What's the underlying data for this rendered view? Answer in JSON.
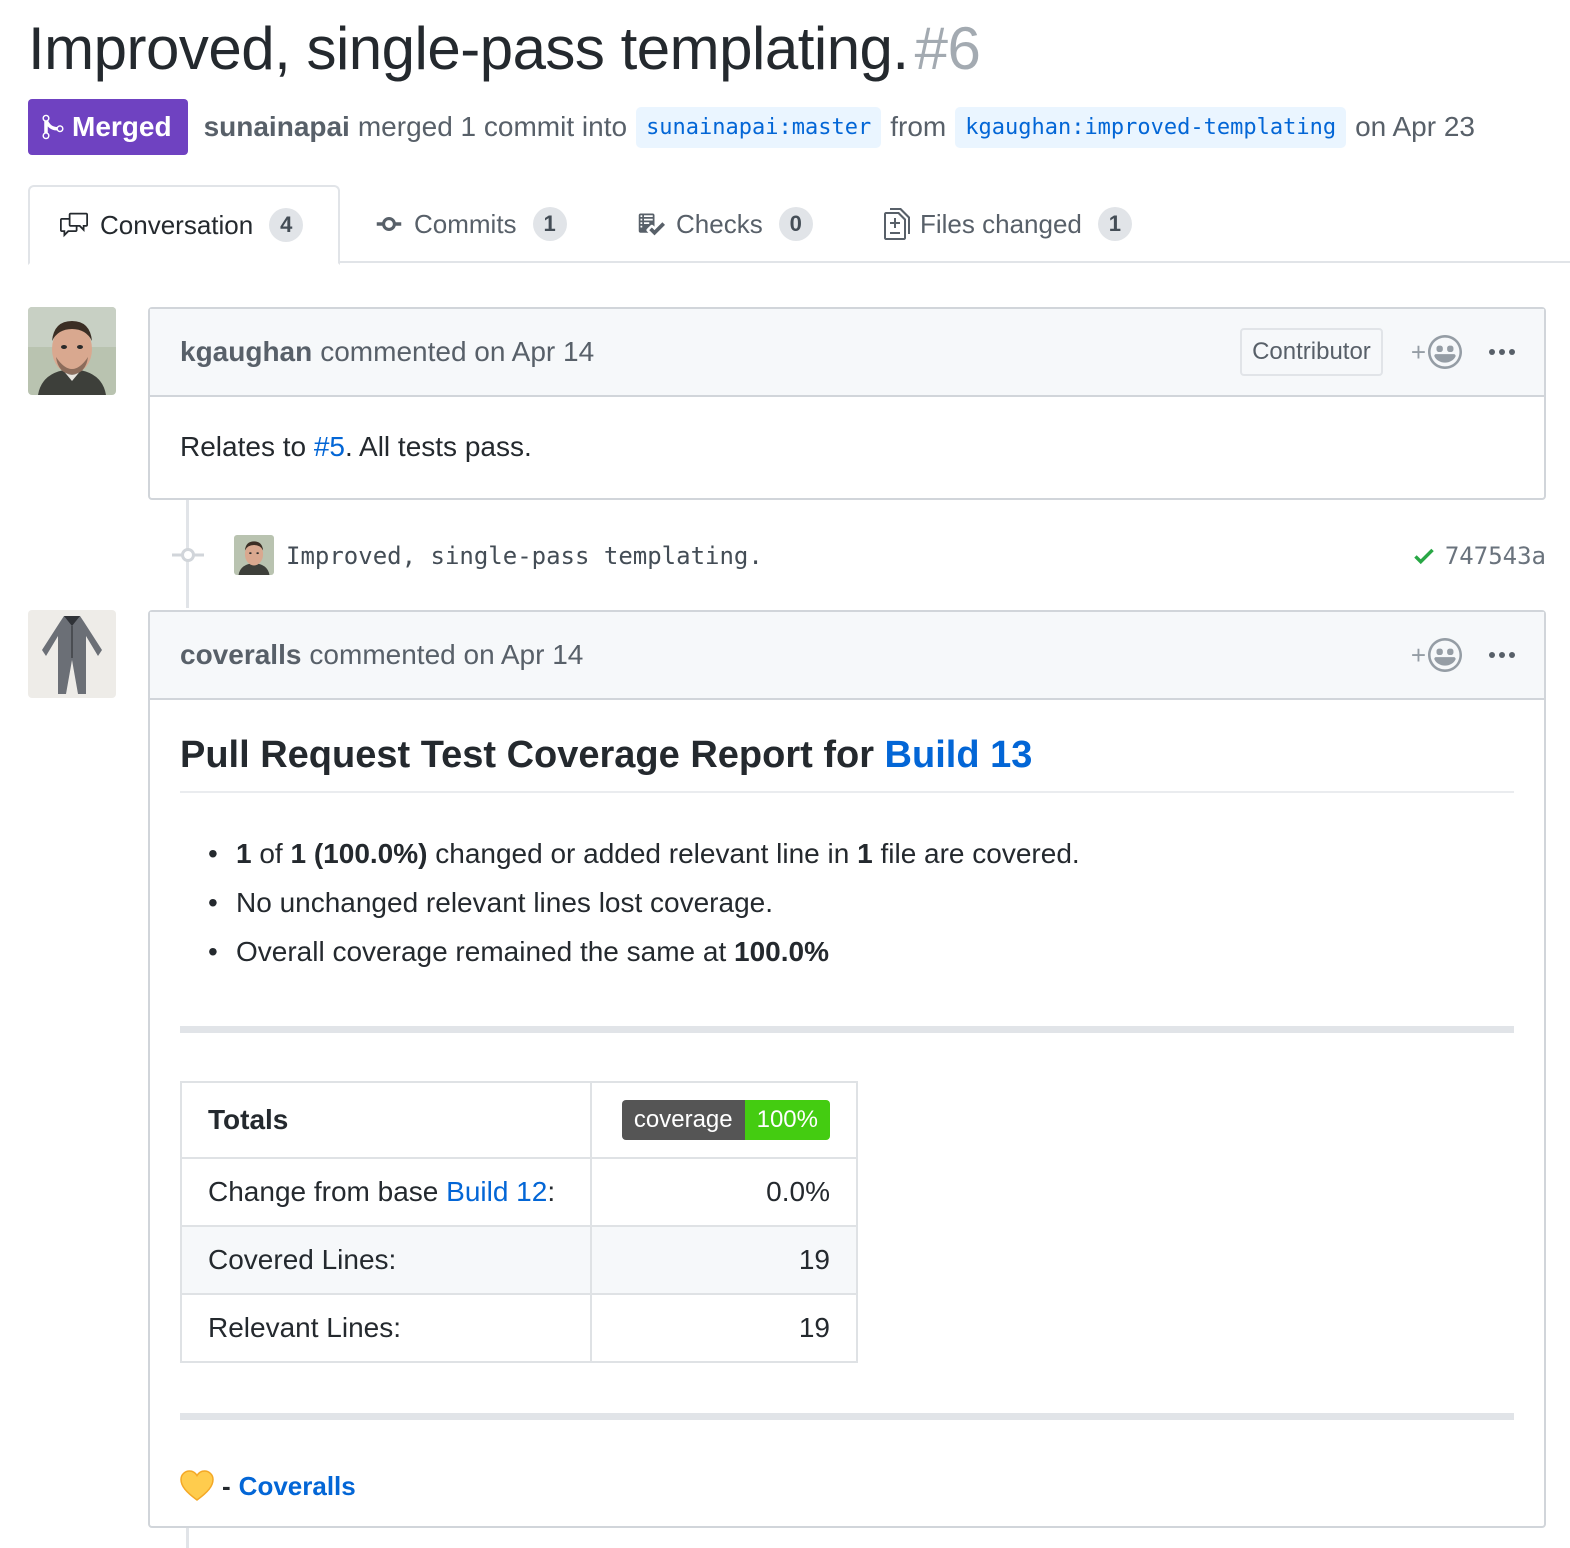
{
  "pr": {
    "title": "Improved, single-pass templating.",
    "number": "#6",
    "state": "Merged",
    "merger": "sunainapai",
    "merge_text": "merged 1 commit into",
    "base_branch": "sunainapai:master",
    "from_text": "from",
    "head_branch": "kgaughan:improved-templating",
    "date_text": "on Apr 23"
  },
  "tabs": [
    {
      "label": "Conversation",
      "count": "4",
      "icon": "comment-discussion-icon"
    },
    {
      "label": "Commits",
      "count": "1",
      "icon": "git-commit-icon"
    },
    {
      "label": "Checks",
      "count": "0",
      "icon": "checklist-icon"
    },
    {
      "label": "Files changed",
      "count": "1",
      "icon": "file-diff-icon"
    }
  ],
  "comment1": {
    "author": "kgaughan",
    "action": "commented on Apr 14",
    "role": "Contributor",
    "body_prefix": "Relates to ",
    "body_link": "#5",
    "body_suffix": ". All tests pass."
  },
  "commit": {
    "message": "Improved, single-pass templating.",
    "sha": "747543a"
  },
  "comment2": {
    "author": "coveralls",
    "action": "commented on Apr 14",
    "heading": "Pull Request Test Coverage Report for ",
    "heading_link": "Build 13",
    "bullets": {
      "b1_a": "1",
      "b1_b": " of ",
      "b1_c": "1 (100.0%)",
      "b1_d": " changed or added relevant line in ",
      "b1_e": "1",
      "b1_f": " file are covered.",
      "b2": "No unchanged relevant lines lost coverage.",
      "b3_a": "Overall coverage remained the same at ",
      "b3_b": "100.0%"
    },
    "table": {
      "totals_label": "Totals",
      "badge_left": "coverage",
      "badge_right": "100%",
      "change_prefix": "Change from base ",
      "change_link": "Build 12",
      "change_suffix": ":",
      "change_value": "0.0%",
      "covered_label": "Covered Lines:",
      "covered_value": "19",
      "relevant_label": "Relevant Lines:",
      "relevant_value": "19"
    },
    "footer_dash": "-",
    "footer_link": "Coveralls"
  },
  "colors": {
    "merged_purple": "#6f42c1",
    "link_blue": "#0366d6",
    "badge_green": "#44cc11",
    "check_green": "#28a745"
  }
}
